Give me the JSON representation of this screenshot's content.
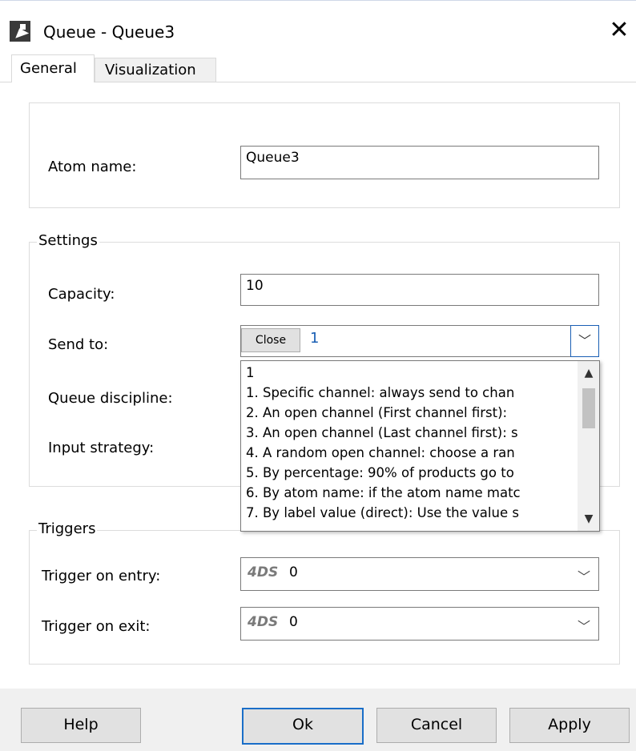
{
  "window": {
    "title": "Queue - Queue3",
    "close_glyph": "✕"
  },
  "tabs": [
    {
      "label": "General",
      "active": true
    },
    {
      "label": "Visualization",
      "active": false
    }
  ],
  "atom": {
    "label": "Atom name:",
    "value": "Queue3"
  },
  "settings": {
    "legend": "Settings",
    "capacity_label": "Capacity:",
    "capacity_value": "10",
    "send_to_label": "Send to:",
    "send_to_close_button": "Close",
    "send_to_value": "1",
    "queue_discipline_label": "Queue discipline:",
    "input_strategy_label": "Input strategy:",
    "send_to_options": [
      "1",
      "1. Specific channel: always send to chan",
      "2. An open channel (First channel first):",
      "3. An open channel (Last channel first): s",
      "4. A random open channel: choose a ran",
      "5. By percentage: 90% of products go to",
      "6. By atom name: if the atom name matc",
      "7. By label value (direct): Use the value s"
    ]
  },
  "triggers": {
    "legend": "Triggers",
    "on_entry_label": "Trigger on entry:",
    "on_entry_prefix": "4DS",
    "on_entry_value": "0",
    "on_exit_label": "Trigger on exit:",
    "on_exit_prefix": "4DS",
    "on_exit_value": "0"
  },
  "footer": {
    "help": "Help",
    "ok": "Ok",
    "cancel": "Cancel",
    "apply": "Apply"
  },
  "icons": {
    "chevron_down": "﹀",
    "scroll_up": "▲",
    "scroll_down": "▼"
  },
  "colors": {
    "accent": "#1a6ec8",
    "value_text": "#1a5fb4"
  }
}
